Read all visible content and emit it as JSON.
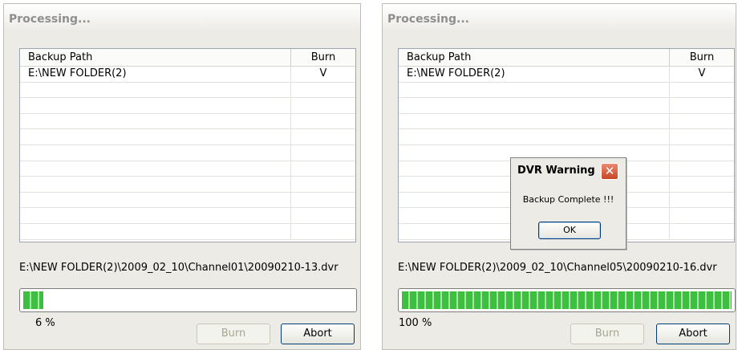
{
  "left": {
    "title": "Processing...",
    "table": {
      "header_path": "Backup Path",
      "header_burn": "Burn",
      "rows": [
        {
          "path": "E:\\NEW FOLDER(2)",
          "burn": "V"
        },
        {
          "path": "",
          "burn": ""
        },
        {
          "path": "",
          "burn": ""
        },
        {
          "path": "",
          "burn": ""
        },
        {
          "path": "",
          "burn": ""
        },
        {
          "path": "",
          "burn": ""
        },
        {
          "path": "",
          "burn": ""
        },
        {
          "path": "",
          "burn": ""
        },
        {
          "path": "",
          "burn": ""
        },
        {
          "path": "",
          "burn": ""
        },
        {
          "path": "",
          "burn": ""
        }
      ]
    },
    "current_file": "E:\\NEW FOLDER(2)\\2009_02_10\\Channel01\\20090210-13.dvr",
    "progress_value": 6,
    "progress_text": "6  %",
    "burn_label": "Burn",
    "abort_label": "Abort"
  },
  "right": {
    "title": "Processing...",
    "table": {
      "header_path": "Backup Path",
      "header_burn": "Burn",
      "rows": [
        {
          "path": "E:\\NEW FOLDER(2)",
          "burn": "V"
        },
        {
          "path": "",
          "burn": ""
        },
        {
          "path": "",
          "burn": ""
        },
        {
          "path": "",
          "burn": ""
        },
        {
          "path": "",
          "burn": ""
        },
        {
          "path": "",
          "burn": ""
        },
        {
          "path": "",
          "burn": ""
        },
        {
          "path": "",
          "burn": ""
        },
        {
          "path": "",
          "burn": ""
        },
        {
          "path": "",
          "burn": ""
        },
        {
          "path": "",
          "burn": ""
        }
      ]
    },
    "current_file": "E:\\NEW FOLDER(2)\\2009_02_10\\Channel05\\20090210-16.dvr",
    "progress_value": 100,
    "progress_text": "100  %",
    "burn_label": "Burn",
    "abort_label": "Abort"
  },
  "dialog": {
    "title": "DVR Warning",
    "message": "Backup Complete !!!",
    "ok_label": "OK",
    "close_icon": "close-icon"
  },
  "colors": {
    "progress_green": "#3fbf3f",
    "dialog_close_red": "#c74525"
  }
}
